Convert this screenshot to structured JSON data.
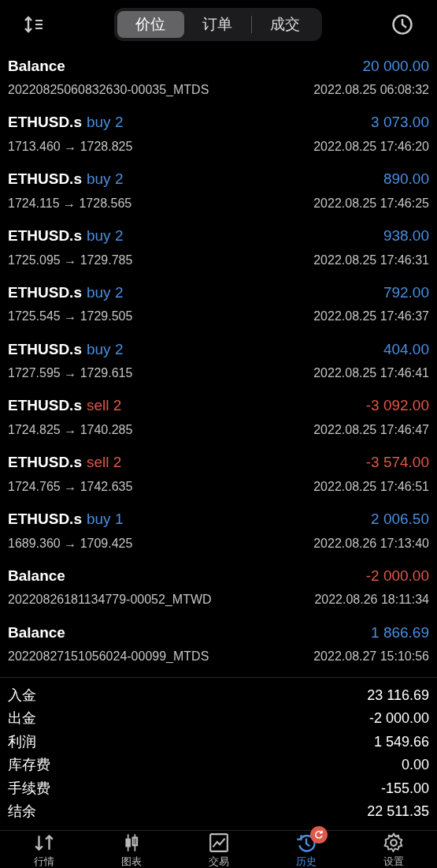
{
  "segments": [
    {
      "label": "价位",
      "selected": true
    },
    {
      "label": "订单",
      "selected": false
    },
    {
      "label": "成交",
      "selected": false
    }
  ],
  "rows": [
    {
      "kind": "balance",
      "symbol": "Balance",
      "amount": "20 000.00",
      "negative": false,
      "detail": "20220825060832630-00035_MTDS",
      "time": "2022.08.25 06:08:32"
    },
    {
      "kind": "trade",
      "symbol": "ETHUSD.s",
      "order": "buy 2",
      "amount": "3 073.00",
      "negative": false,
      "detail": "1713.460 → 1728.825",
      "time": "2022.08.25 17:46:20"
    },
    {
      "kind": "trade",
      "symbol": "ETHUSD.s",
      "order": "buy 2",
      "amount": "890.00",
      "negative": false,
      "detail": "1724.115 → 1728.565",
      "time": "2022.08.25 17:46:25"
    },
    {
      "kind": "trade",
      "symbol": "ETHUSD.s",
      "order": "buy 2",
      "amount": "938.00",
      "negative": false,
      "detail": "1725.095 → 1729.785",
      "time": "2022.08.25 17:46:31"
    },
    {
      "kind": "trade",
      "symbol": "ETHUSD.s",
      "order": "buy 2",
      "amount": "792.00",
      "negative": false,
      "detail": "1725.545 → 1729.505",
      "time": "2022.08.25 17:46:37"
    },
    {
      "kind": "trade",
      "symbol": "ETHUSD.s",
      "order": "buy 2",
      "amount": "404.00",
      "negative": false,
      "detail": "1727.595 → 1729.615",
      "time": "2022.08.25 17:46:41"
    },
    {
      "kind": "trade",
      "symbol": "ETHUSD.s",
      "order": "sell 2",
      "amount": "-3 092.00",
      "negative": true,
      "detail": "1724.825 → 1740.285",
      "time": "2022.08.25 17:46:47"
    },
    {
      "kind": "trade",
      "symbol": "ETHUSD.s",
      "order": "sell 2",
      "amount": "-3 574.00",
      "negative": true,
      "detail": "1724.765 → 1742.635",
      "time": "2022.08.25 17:46:51"
    },
    {
      "kind": "trade",
      "symbol": "ETHUSD.s",
      "order": "buy 1",
      "amount": "2 006.50",
      "negative": false,
      "detail": "1689.360 → 1709.425",
      "time": "2022.08.26 17:13:40"
    },
    {
      "kind": "balance",
      "symbol": "Balance",
      "amount": "-2 000.00",
      "negative": true,
      "detail": "20220826181134779-00052_MTWD",
      "time": "2022.08.26 18:11:34"
    },
    {
      "kind": "balance",
      "symbol": "Balance",
      "amount": "1 866.69",
      "negative": false,
      "detail": "20220827151056024-00099_MTDS",
      "time": "2022.08.27 15:10:56"
    }
  ],
  "summary": [
    {
      "label": "入金",
      "value": "23 116.69"
    },
    {
      "label": "出金",
      "value": "-2 000.00"
    },
    {
      "label": "利润",
      "value": "1 549.66"
    },
    {
      "label": "库存费",
      "value": "0.00"
    },
    {
      "label": "手续费",
      "value": "-155.00"
    },
    {
      "label": "结余",
      "value": "22 511.35"
    }
  ],
  "nav": [
    {
      "kind": "quotes",
      "label": "行情",
      "selected": false
    },
    {
      "kind": "chart",
      "label": "图表",
      "selected": false
    },
    {
      "kind": "trade",
      "label": "交易",
      "selected": false
    },
    {
      "kind": "history",
      "label": "历史",
      "selected": true,
      "badge": true
    },
    {
      "kind": "settings",
      "label": "设置",
      "selected": false
    }
  ]
}
